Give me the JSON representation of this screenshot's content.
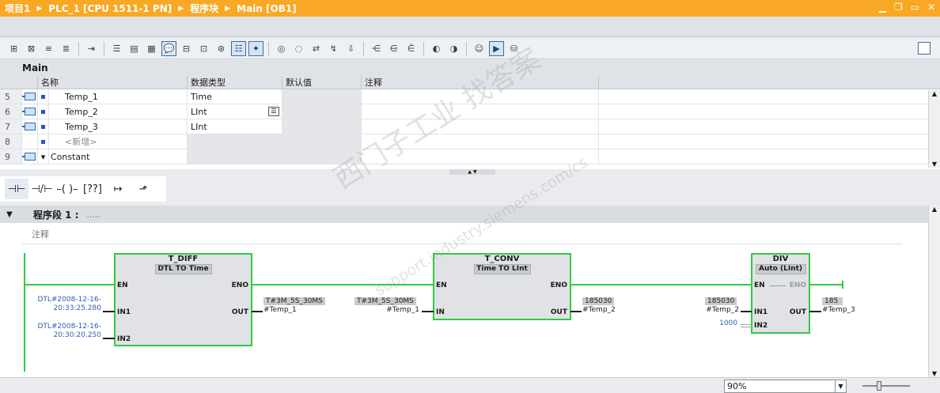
{
  "breadcrumb": [
    "项目1",
    "PLC_1 [CPU 1511-1 PN]",
    "程序块",
    "Main [OB1]"
  ],
  "window_buttons": [
    "minimize-icon",
    "restore-icon",
    "maximize-icon",
    "close-icon"
  ],
  "block_title": "Main",
  "interface": {
    "headers": [
      "名称",
      "数据类型",
      "默认值",
      "注释"
    ],
    "rows": [
      {
        "num": "5",
        "name": "Temp_1",
        "type": "Time"
      },
      {
        "num": "6",
        "name": "Temp_2",
        "type": "LInt"
      },
      {
        "num": "7",
        "name": "Temp_3",
        "type": "LInt"
      },
      {
        "num": "8",
        "name": "<新增>",
        "type": ""
      },
      {
        "num": "9",
        "name": "Constant",
        "type": ""
      }
    ]
  },
  "network": {
    "title": "程序段 1 :",
    "dots": ".....",
    "comment": "注释"
  },
  "blocks": {
    "tdiff": {
      "name": "T_DIFF",
      "sub": "DTL  TO  Time",
      "en": "EN",
      "eno": "ENO",
      "in1": "IN1",
      "in2": "IN2",
      "out": "OUT"
    },
    "tconv": {
      "name": "T_CONV",
      "sub": "Time  TO  LInt",
      "en": "EN",
      "eno": "ENO",
      "in": "IN",
      "out": "OUT"
    },
    "div": {
      "name": "DIV",
      "sub": "Auto (LInt)",
      "en": "EN",
      "eno": "ENO",
      "in1": "IN1",
      "in2": "IN2",
      "out": "OUT"
    }
  },
  "operands": {
    "in1_a": "DTL#2008-12-16-",
    "in1_b": "20:33:25.280",
    "in2_a": "DTL#2008-12-16-",
    "in2_b": "20:30:20.250",
    "tdiff_out_val": "T#3M_5S_30MS",
    "tdiff_out_var": "#Temp_1",
    "tconv_in_val": "T#3M_5S_30MS",
    "tconv_in_var": "#Temp_1",
    "tconv_out_val": "185030",
    "tconv_out_var": "#Temp_2",
    "div_in1_val": "185030",
    "div_in1_var": "#Temp_2",
    "div_in2_val": "1000",
    "div_out_val": "185",
    "div_out_var": "#Temp_3"
  },
  "zoom": "90%",
  "watermark": {
    "line1": "西门子工业 找答案",
    "line2": "support.industry.siemens.com/cs"
  }
}
